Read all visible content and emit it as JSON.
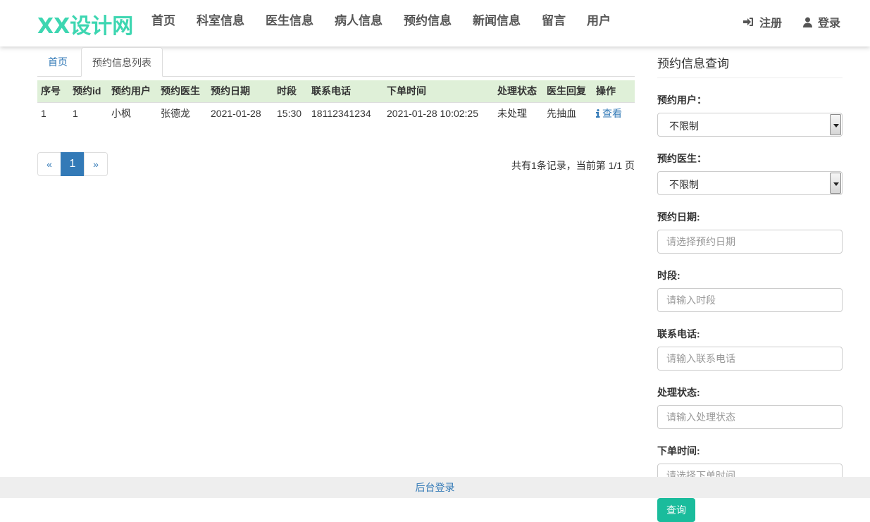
{
  "header": {
    "logo": "XX设计网",
    "nav": [
      "首页",
      "科室信息",
      "医生信息",
      "病人信息",
      "预约信息",
      "新闻信息",
      "留言",
      "用户"
    ],
    "register": "注册",
    "login": "登录"
  },
  "tabs": {
    "home": "首页",
    "current": "预约信息列表"
  },
  "table": {
    "headers": [
      "序号",
      "预约id",
      "预约用户",
      "预约医生",
      "预约日期",
      "时段",
      "联系电话",
      "下单时间",
      "处理状态",
      "医生回复",
      "操作"
    ],
    "rows": [
      {
        "index": "1",
        "id": "1",
        "user": "小枫",
        "doctor": "张德龙",
        "date": "2021-01-28",
        "slot": "15:30",
        "phone": "18112341234",
        "order_time": "2021-01-28 10:02:25",
        "status": "未处理",
        "reply": "先抽血",
        "action": "查看"
      }
    ]
  },
  "pagination": {
    "prev": "«",
    "current": "1",
    "next": "»",
    "summary": "共有1条记录，当前第 1/1 页"
  },
  "sidebar": {
    "title": "预约信息查询",
    "fields": {
      "user_label": "预约用户：",
      "user_value": "不限制",
      "doctor_label": "预约医生：",
      "doctor_value": "不限制",
      "date_label": "预约日期:",
      "date_placeholder": "请选择预约日期",
      "slot_label": "时段:",
      "slot_placeholder": "请输入时段",
      "phone_label": "联系电话:",
      "phone_placeholder": "请输入联系电话",
      "status_label": "处理状态:",
      "status_placeholder": "请输入处理状态",
      "order_time_label": "下单时间:",
      "order_time_placeholder": "请选择下单时间"
    },
    "query_button": "查询"
  },
  "footer": {
    "admin_login": "后台登录"
  },
  "colors": {
    "logo": "#3dd6b1",
    "link": "#337ab7",
    "table_header_bg": "#dff0d8",
    "button": "#1abc9c"
  }
}
